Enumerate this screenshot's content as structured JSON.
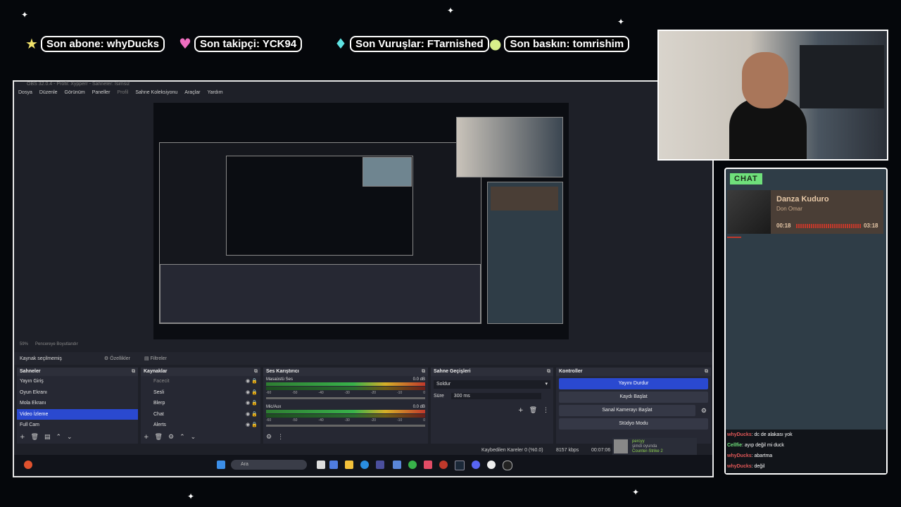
{
  "banner": {
    "sub": "Son abone: whyDucks",
    "follow": "Son takipçi: YCK94",
    "cheer": "Son Vuruşlar: FTarnished",
    "raid": "Son baskın: tomrishim"
  },
  "obs": {
    "title": "OBS 32.0.4 - Profil: Xypperr - Sahneler: Isimsiz",
    "menu": [
      "Dosya",
      "Düzenle",
      "Görünüm",
      "Paneller",
      "Profil",
      "Sahne Koleksiyonu",
      "Araçlar",
      "Yardım"
    ],
    "zoom": "59%",
    "zoom_fit": "Pencereye Boyutlandır",
    "source_bar": {
      "none_selected": "Kaynak seçilmemiş",
      "properties": "Özellikler",
      "filters": "Filtreler"
    },
    "scenes": {
      "title": "Sahneler",
      "items": [
        "Yayın Giriş",
        "Oyun Ekranı",
        "Mola Ekranı",
        "Video İzleme",
        "Full Cam"
      ],
      "selected_index": 3
    },
    "sources": {
      "title": "Kaynaklar",
      "items": [
        "Facecit",
        "Sesli",
        "Blerp",
        "Chat",
        "Alerts"
      ]
    },
    "mixer": {
      "title": "Ses Karıştırıcı",
      "channels": [
        {
          "name": "Masaüstü Ses",
          "db": "0.0 dB"
        },
        {
          "name": "Mic/Aux",
          "db": "0.0 dB"
        }
      ],
      "ticks": [
        "-60",
        "-55",
        "-50",
        "-45",
        "-40",
        "-35",
        "-30",
        "-25",
        "-20",
        "-15",
        "-10",
        "-5",
        "0"
      ]
    },
    "transitions": {
      "title": "Sahne Geçişleri",
      "type": "Soldur",
      "duration_label": "Süre",
      "duration": "300 ms"
    },
    "controls": {
      "title": "Kontroller",
      "stream": "Yayını Durdur",
      "record": "Kaydı Başlat",
      "virtualcam": "Sanal Kamerayı Başlat",
      "studio": "Stüdyo Modu"
    },
    "status": {
      "dropped": "Kaybedilen Kareler 0 (%0.0)",
      "bitrate": "8157 kbps",
      "time": "00:07:06"
    },
    "notification": {
      "user": "percyy",
      "line1": "şimdi oyunda",
      "game": "Counter-Strike 2"
    },
    "taskbar": {
      "search": "Ara"
    }
  },
  "chat": {
    "label": "CHAT",
    "now_playing": {
      "title": "Danza Kuduro",
      "artist": "Don Omar",
      "elapsed": "00:18",
      "total": "03:18",
      "progress": 0.09
    },
    "messages": [
      {
        "user": "whyDucks",
        "text": ": dc de alakası yok"
      },
      {
        "user": "Cellfie",
        "text": ": ayıp değil mi duck"
      },
      {
        "user": "whyDucks",
        "text": ": abartma"
      },
      {
        "user": "whyDucks",
        "text": ": değil"
      }
    ]
  },
  "colors": {
    "accent": "#2a49d0",
    "chat_label": "#6fe07b",
    "chat_bg": "#2f3d47",
    "music_bg": "#4a3e36"
  }
}
